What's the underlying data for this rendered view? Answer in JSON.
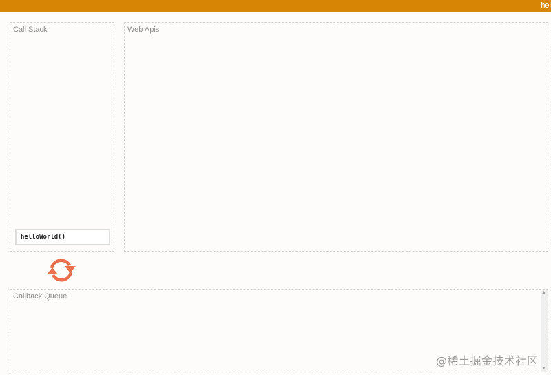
{
  "header": {
    "title": "hel"
  },
  "call_stack": {
    "title": "Call Stack",
    "frames": [
      "helloWorld()"
    ]
  },
  "web_apis": {
    "title": "Web Apis"
  },
  "event_loop": {
    "icon": "refresh-icon",
    "color": "#ec6f4e"
  },
  "callback_queue": {
    "title": "Callback Queue",
    "scroll_up": "▲",
    "scroll_down": "▼"
  },
  "watermark": "@稀土掘金技术社区"
}
